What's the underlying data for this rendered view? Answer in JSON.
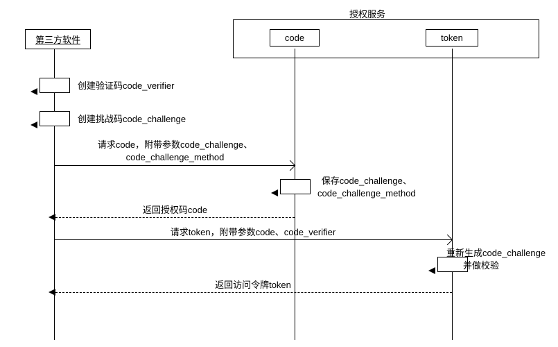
{
  "participants": {
    "client": "第三方软件",
    "auth_group": "授权服务",
    "code": "code",
    "token": "token"
  },
  "messages": {
    "m1": "创建验证码code_verifier",
    "m2": "创建挑战码code_challenge",
    "m3_l1": "请求code，附带参数code_challenge、",
    "m3_l2": "code_challenge_method",
    "m4_l1": "保存code_challenge、",
    "m4_l2": "code_challenge_method",
    "m5": "返回授权码code",
    "m6": "请求token，附带参数code、code_verifier",
    "m7_l1": "重新生成code_challenge",
    "m7_l2": "并做校验",
    "m8": "返回访问令牌token"
  },
  "chart_data": {
    "type": "sequence_diagram",
    "participants": [
      {
        "id": "client",
        "name": "第三方软件"
      },
      {
        "id": "code",
        "name": "code",
        "group": "授权服务"
      },
      {
        "id": "token",
        "name": "token",
        "group": "授权服务"
      }
    ],
    "groups": [
      {
        "name": "授权服务",
        "members": [
          "code",
          "token"
        ]
      }
    ],
    "messages": [
      {
        "from": "client",
        "to": "client",
        "text": "创建验证码code_verifier",
        "kind": "self"
      },
      {
        "from": "client",
        "to": "client",
        "text": "创建挑战码code_challenge",
        "kind": "self"
      },
      {
        "from": "client",
        "to": "code",
        "text": "请求code，附带参数code_challenge、code_challenge_method",
        "kind": "sync"
      },
      {
        "from": "code",
        "to": "code",
        "text": "保存code_challenge、code_challenge_method",
        "kind": "self"
      },
      {
        "from": "code",
        "to": "client",
        "text": "返回授权码code",
        "kind": "return"
      },
      {
        "from": "client",
        "to": "token",
        "text": "请求token，附带参数code、code_verifier",
        "kind": "sync"
      },
      {
        "from": "token",
        "to": "token",
        "text": "重新生成code_challenge并做校验",
        "kind": "self"
      },
      {
        "from": "token",
        "to": "client",
        "text": "返回访问令牌token",
        "kind": "return"
      }
    ]
  }
}
